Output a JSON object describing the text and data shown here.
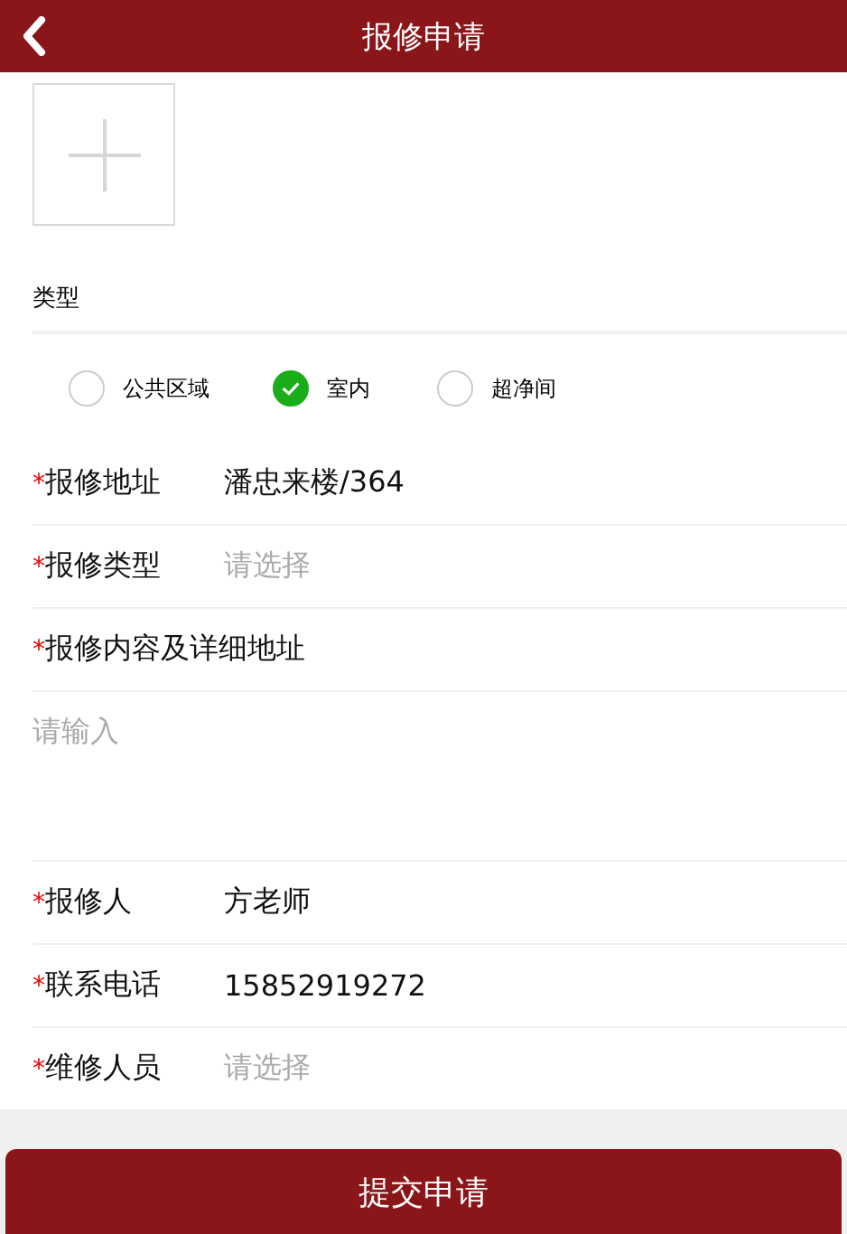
{
  "header": {
    "title": "报修申请"
  },
  "type_section": {
    "label": "类型",
    "options": [
      {
        "label": "公共区域",
        "selected": false
      },
      {
        "label": "室内",
        "selected": true
      },
      {
        "label": "超净间",
        "selected": false
      }
    ]
  },
  "fields": [
    {
      "kind": "input",
      "mark": "*",
      "label": "报修地址",
      "value": "潘忠来楼/364"
    },
    {
      "kind": "select",
      "mark": "*",
      "label": "报修类型",
      "placeholder": "请选择"
    },
    {
      "kind": "heading",
      "mark": "*",
      "label": "报修内容及详细地址"
    },
    {
      "kind": "textarea",
      "placeholder": "请输入"
    },
    {
      "kind": "input",
      "mark": "*",
      "label": "报修人",
      "value": "方老师"
    },
    {
      "kind": "input",
      "mark": "*",
      "label": "联系电话",
      "value": "15852919272"
    },
    {
      "kind": "select",
      "mark": "*",
      "label": "维修人员",
      "placeholder": "请选择"
    }
  ],
  "submit_button": "提交申请"
}
